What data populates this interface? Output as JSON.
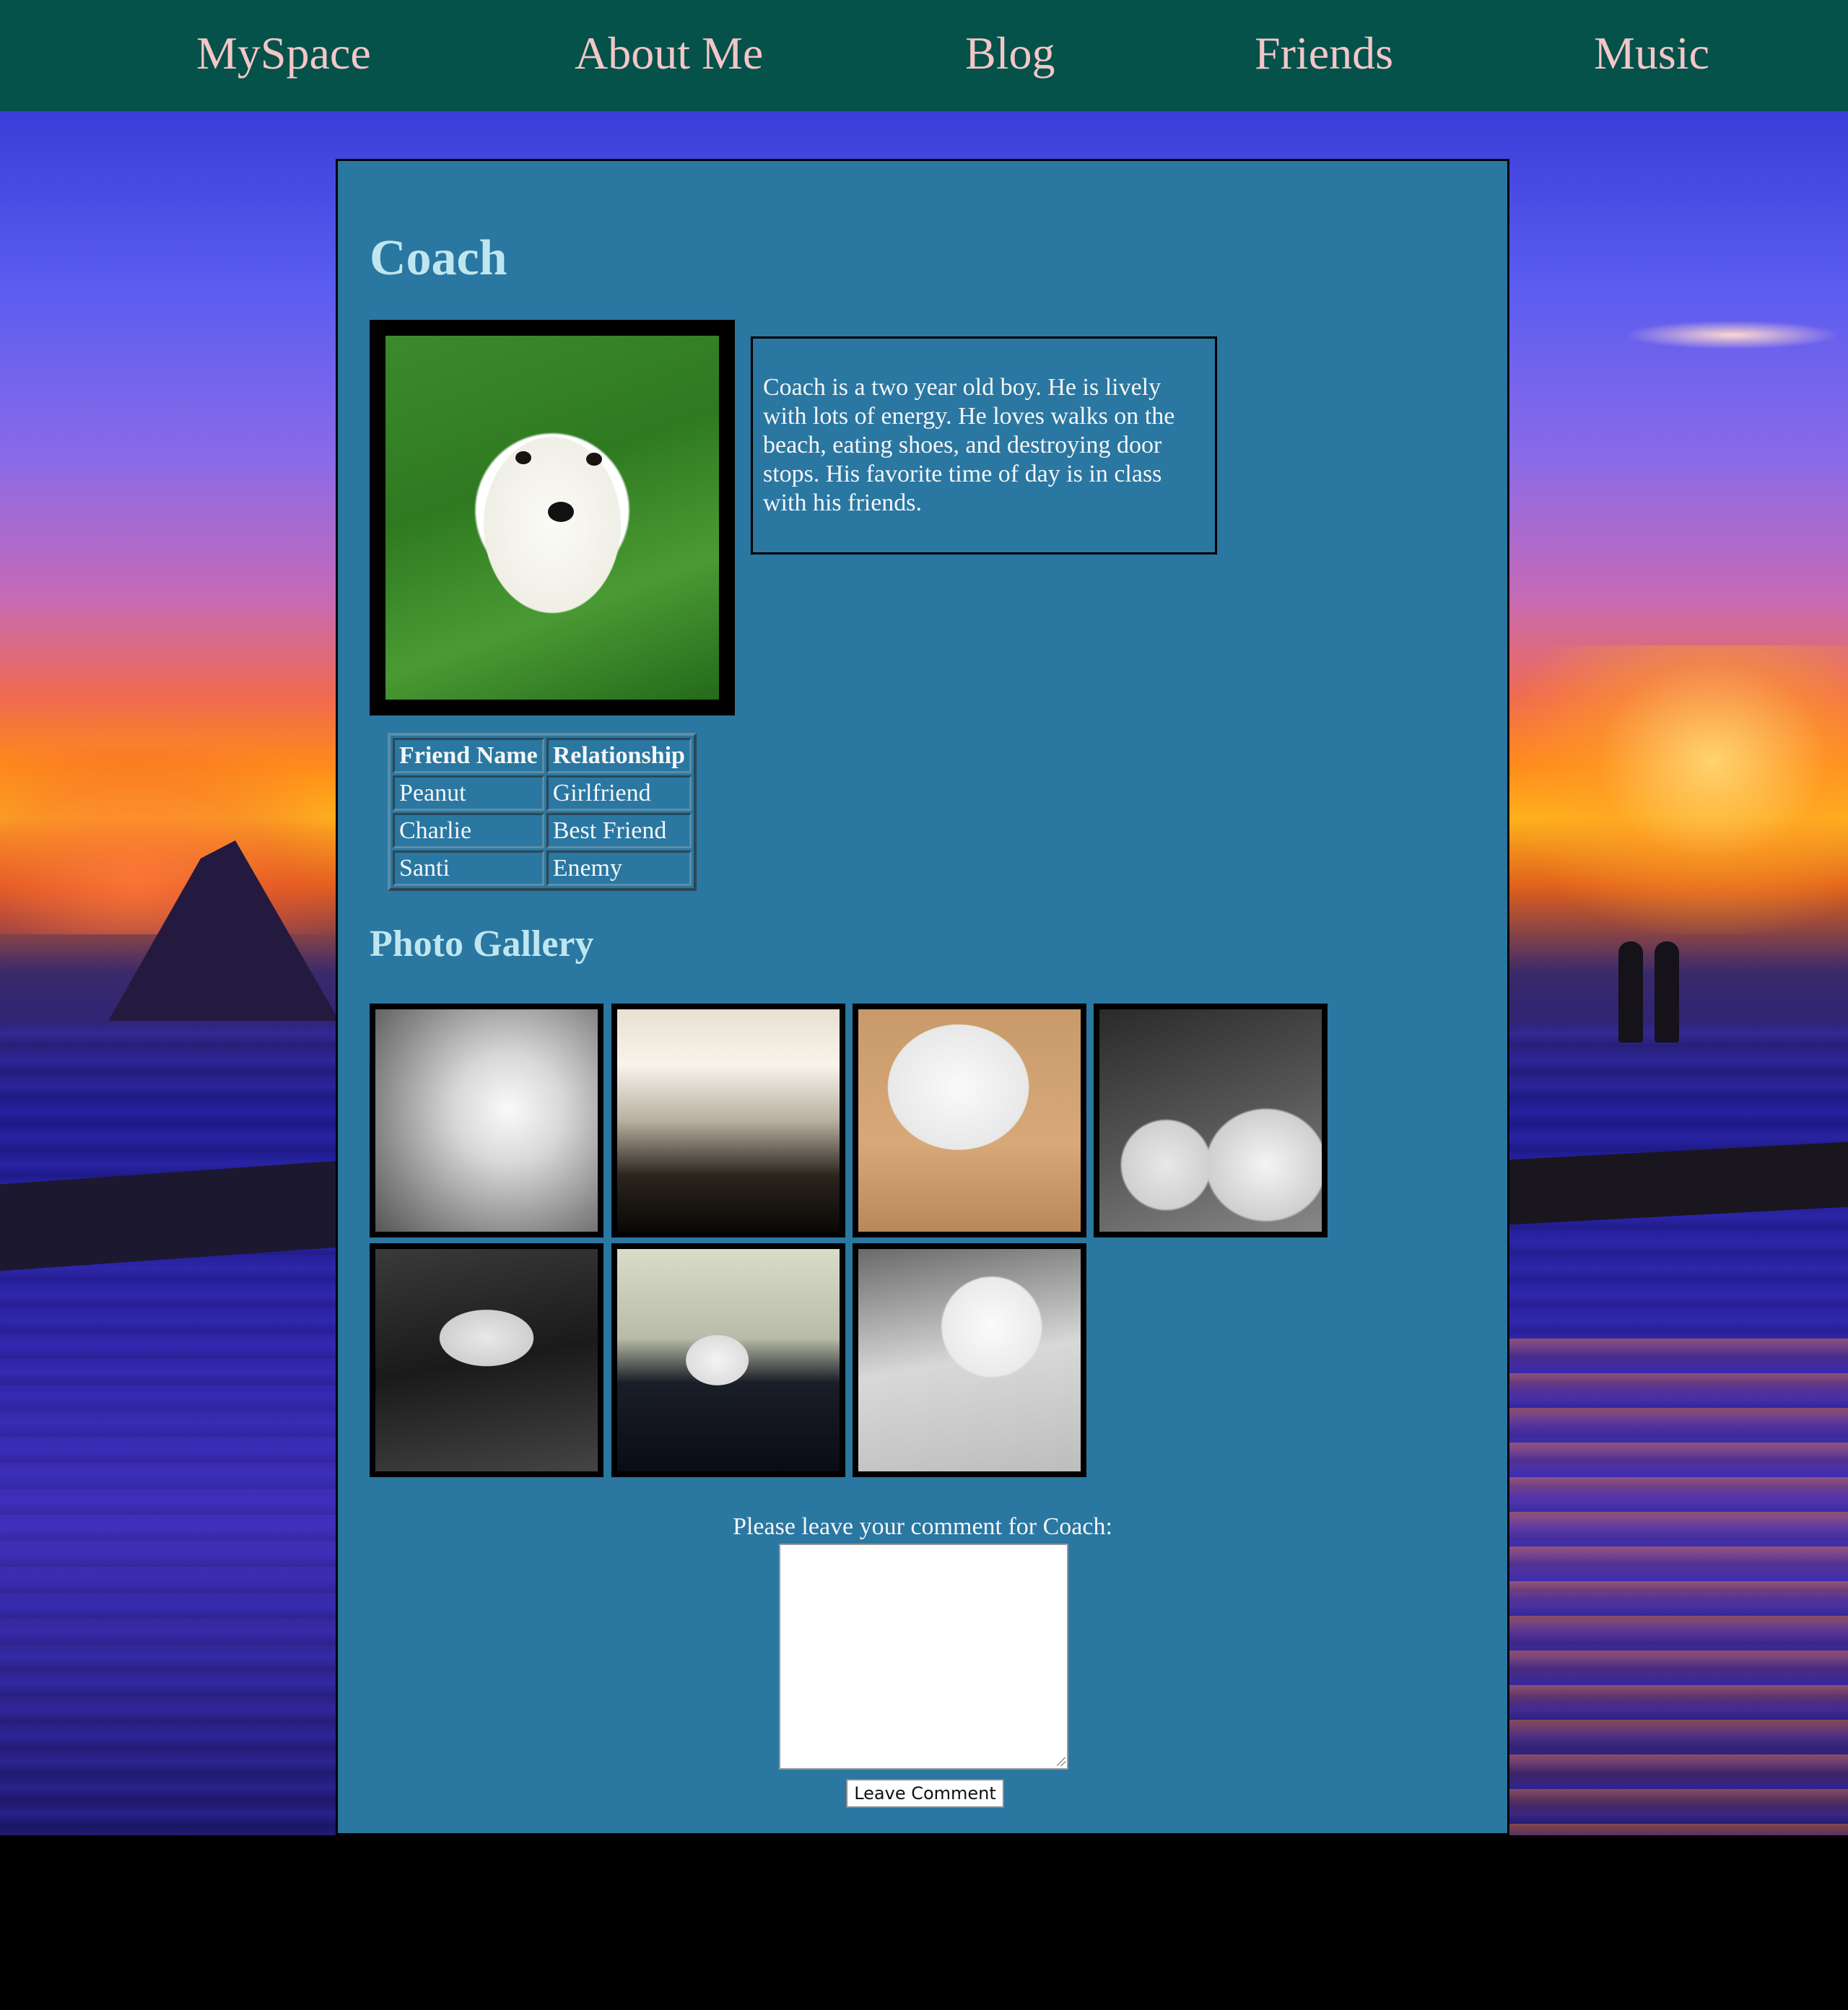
{
  "nav": {
    "items": [
      {
        "label": "MySpace"
      },
      {
        "label": "About Me"
      },
      {
        "label": "Blog"
      },
      {
        "label": "Friends"
      },
      {
        "label": "Music"
      }
    ]
  },
  "profile": {
    "name": "Coach",
    "bio": "Coach is a two year old boy. He is lively with lots of energy. He loves walks on the beach, eating shoes, and destroying door stops. His favorite time of day is in class with his friends."
  },
  "friends_table": {
    "headers": [
      "Friend Name",
      "Relationship"
    ],
    "rows": [
      [
        "Peanut",
        "Girlfriend"
      ],
      [
        "Charlie",
        "Best Friend"
      ],
      [
        "Santi",
        "Enemy"
      ]
    ]
  },
  "gallery": {
    "title": "Photo Gallery",
    "photo_count": 7
  },
  "comment": {
    "label": "Please leave your comment for Coach:",
    "value": "",
    "button_label": "Leave Comment"
  },
  "colors": {
    "nav_bg": "#04524a",
    "nav_text": "#f4c6c8",
    "panel_bg": "#2a77a1",
    "heading": "#bfe6ef"
  }
}
